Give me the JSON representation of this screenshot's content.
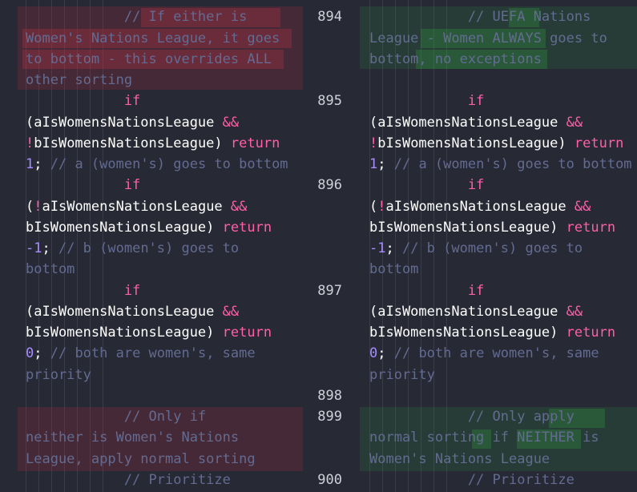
{
  "editor": {
    "colors": {
      "background": "#272935",
      "comment": "#636b91",
      "keyword": "#ff5fa8",
      "number": "#a88cff",
      "identifier": "#ffffff",
      "removed_bg": "#3a2430",
      "added_bg": "#2a3a32"
    },
    "line_numbers": {
      "n894": "894",
      "n895": "895",
      "n896": "896",
      "n897": "897",
      "n898": "898",
      "n899": "899",
      "n900": "900"
    },
    "left": {
      "l1": "            // If either is",
      "l2": "Women's Nations League, it goes",
      "l3": "to bottom - this overrides ALL",
      "l4": "other sorting",
      "l5_if": "            if",
      "l6_a": "(aIsWomensNationsLeague",
      "l6_op": " &&",
      "l7_not": "!",
      "l7_b": "bIsWomensNationsLeague)",
      "l7_ret": " return",
      "l8_num": "1",
      "l8_semi": ";",
      "l8_c": " // a (women's) goes to bottom",
      "l9_if": "            if",
      "l10_paren": "(",
      "l10_not": "!",
      "l10_a": "aIsWomensNationsLeague",
      "l10_op": " &&",
      "l11_b": "bIsWomensNationsLeague)",
      "l11_ret": " return",
      "l12_num": "-1",
      "l12_semi": ";",
      "l12_c": " // b (women's) goes to",
      "l13_c": "bottom",
      "l14_if": "            if",
      "l15_a": "(aIsWomensNationsLeague",
      "l15_op": " &&",
      "l16_b": "bIsWomensNationsLeague)",
      "l16_ret": " return",
      "l17_num": "0",
      "l17_semi": ";",
      "l17_c": " // both are women's, same",
      "l18_c": "priority",
      "l19_c": "            // Only if",
      "l20_c": "neither is Women's Nations",
      "l21_c": "League, apply normal sorting",
      "l22_c": "            // Prioritize"
    },
    "right": {
      "l1": "            // UEFA Nations",
      "l2": "League - Women ALWAYS goes to",
      "l3": "bottom, no exceptions",
      "l5_if": "            if",
      "l6_a": "(aIsWomensNationsLeague",
      "l6_op": " &&",
      "l7_not": "!",
      "l7_b": "bIsWomensNationsLeague)",
      "l7_ret": " return",
      "l8_num": "1",
      "l8_semi": ";",
      "l8_c": " // a (women's) goes to bottom",
      "l9_if": "            if",
      "l10_paren": "(",
      "l10_not": "!",
      "l10_a": "aIsWomensNationsLeague",
      "l10_op": " &&",
      "l11_b": "bIsWomensNationsLeague)",
      "l11_ret": " return",
      "l12_num": "-1",
      "l12_semi": ";",
      "l12_c": " // b (women's) goes to",
      "l13_c": "bottom",
      "l14_if": "            if",
      "l15_a": "(aIsWomensNationsLeague",
      "l15_op": " &&",
      "l16_b": "bIsWomensNationsLeague)",
      "l16_ret": " return",
      "l17_num": "0",
      "l17_semi": ";",
      "l17_c": " // both are women's, same",
      "l18_c": "priority",
      "l19_c": "            // Only apply",
      "l20_c": "normal sorting if NEITHER is",
      "l21_c": "Women's Nations League",
      "l22_c": "            // Prioritize"
    }
  }
}
